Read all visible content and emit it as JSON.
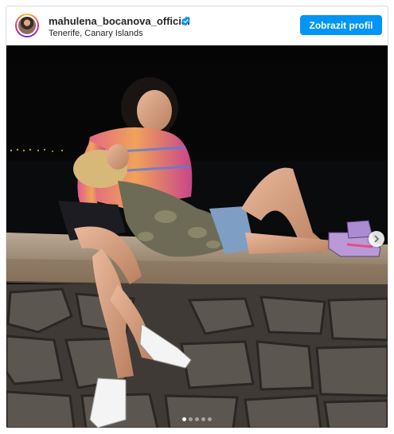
{
  "post": {
    "username": "mahulena_bocanova_official",
    "verified": true,
    "location": "Tenerife, Canary Islands",
    "profile_button_label": "Zobrazit profil"
  },
  "carousel": {
    "slide_count": 5,
    "active_index": 0,
    "next_icon": "chevron-right-icon"
  },
  "colors": {
    "accent": "#0095f6",
    "text": "#262626",
    "border": "#dbdbdb"
  }
}
